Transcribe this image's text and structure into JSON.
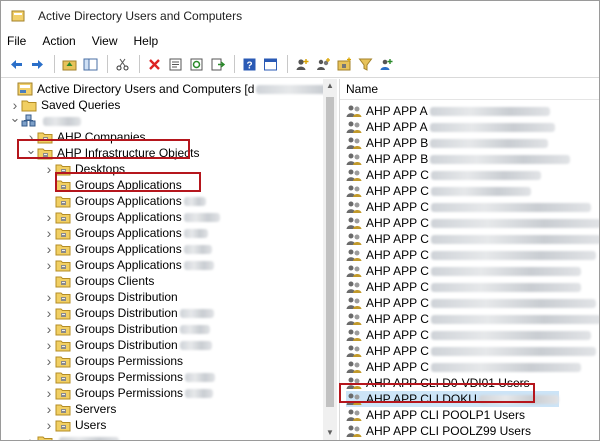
{
  "window": {
    "title": "Active Directory Users and Computers"
  },
  "menu": [
    "File",
    "Action",
    "View",
    "Help"
  ],
  "toolbar": [
    "back-arrow-icon",
    "forward-arrow-icon",
    "|",
    "up-folder-icon",
    "show-tree-icon",
    "|",
    "cut-icon",
    "|",
    "delete-icon",
    "properties-icon",
    "refresh-icon",
    "export-list-icon",
    "|",
    "help-icon",
    "console-icon",
    "|",
    "new-user-icon",
    "new-group-icon",
    "new-ou-icon",
    "filter-icon",
    "add-to-group-icon"
  ],
  "tree": [
    {
      "label": "Active Directory Users and Computers [d",
      "blur": [
        "dl",
        true
      ],
      "suffix": "]",
      "depth": 0,
      "expander": "none",
      "icon": "adcomputer",
      "blurw": 100
    },
    {
      "label": "Saved Queries",
      "depth": 1,
      "expander": "right",
      "icon": "folder"
    },
    {
      "label": "",
      "depth": 1,
      "expander": "down",
      "icon": "domain",
      "blurw": 38
    },
    {
      "label": "AHP Companies",
      "depth": 2,
      "expander": "right",
      "icon": "ou"
    },
    {
      "label": "AHP Infrastructure Objects",
      "depth": 2,
      "expander": "down",
      "icon": "ou"
    },
    {
      "label": "Desktops",
      "depth": 3,
      "expander": "right",
      "icon": "ou"
    },
    {
      "label": "Groups Applications",
      "depth": 3,
      "expander": "none",
      "icon": "ou"
    },
    {
      "label": "Groups Applications",
      "depth": 3,
      "expander": "none",
      "icon": "ou",
      "blurw": 22
    },
    {
      "label": "Groups Applications",
      "depth": 3,
      "expander": "right",
      "icon": "ou",
      "blurw": 36
    },
    {
      "label": "Groups Applications",
      "depth": 3,
      "expander": "right",
      "icon": "ou",
      "blurw": 24
    },
    {
      "label": "Groups Applications",
      "depth": 3,
      "expander": "right",
      "icon": "ou",
      "blurw": 28
    },
    {
      "label": "Groups Applications",
      "depth": 3,
      "expander": "right",
      "icon": "ou",
      "blurw": 30
    },
    {
      "label": "Groups Clients",
      "depth": 3,
      "expander": "none",
      "icon": "ou"
    },
    {
      "label": "Groups Distribution",
      "depth": 3,
      "expander": "right",
      "icon": "ou"
    },
    {
      "label": "Groups Distribution",
      "depth": 3,
      "expander": "right",
      "icon": "ou",
      "blurw": 34
    },
    {
      "label": "Groups Distribution",
      "depth": 3,
      "expander": "right",
      "icon": "ou",
      "blurw": 30
    },
    {
      "label": "Groups Distribution",
      "depth": 3,
      "expander": "right",
      "icon": "ou",
      "blurw": 32
    },
    {
      "label": "Groups Permissions",
      "depth": 3,
      "expander": "right",
      "icon": "ou"
    },
    {
      "label": "Groups Permissions",
      "depth": 3,
      "expander": "right",
      "icon": "ou",
      "blurw": 30
    },
    {
      "label": "Groups Permissions",
      "depth": 3,
      "expander": "right",
      "icon": "ou",
      "blurw": 28
    },
    {
      "label": "Servers",
      "depth": 3,
      "expander": "right",
      "icon": "ou"
    },
    {
      "label": "Users",
      "depth": 3,
      "expander": "right",
      "icon": "ou"
    },
    {
      "label": "",
      "depth": 2,
      "expander": "right",
      "icon": "ou",
      "blurw": 60
    }
  ],
  "list": {
    "column": "Name",
    "rows": [
      {
        "label": "AHP APP A",
        "blurw": 120
      },
      {
        "label": "AHP APP A",
        "blurw": 125
      },
      {
        "label": "AHP APP B",
        "blurw": 118
      },
      {
        "label": "AHP APP B",
        "blurw": 140
      },
      {
        "label": "AHP APP C",
        "blurw": 110
      },
      {
        "label": "AHP APP C",
        "blurw": 100
      },
      {
        "label": "AHP APP C",
        "blurw": 160
      },
      {
        "label": "AHP APP C",
        "blurw": 170
      },
      {
        "label": "AHP APP C",
        "blurw": 170
      },
      {
        "label": "AHP APP C",
        "blurw": 165
      },
      {
        "label": "AHP APP C",
        "blurw": 150
      },
      {
        "label": "AHP APP C",
        "blurw": 150
      },
      {
        "label": "AHP APP C",
        "blurw": 165
      },
      {
        "label": "AHP APP C",
        "blurw": 170
      },
      {
        "label": "AHP APP C",
        "blurw": 160
      },
      {
        "label": "AHP APP C",
        "blurw": 165
      },
      {
        "label": "AHP APP C",
        "blurw": 150
      },
      {
        "label": "AHP APP CLI D0-VDI01 Users",
        "blurw": 0
      },
      {
        "label": "AHP APP CLI DOKU",
        "blurw": 80,
        "selected": true
      },
      {
        "label": "AHP APP CLI POOLP1 Users",
        "blurw": 0
      },
      {
        "label": "AHP APP CLI POOLZ99 Users",
        "blurw": 0
      }
    ]
  },
  "colors": {
    "highlight": "#b5161d",
    "folder": "#e8c35a",
    "selection": "#cce4f7"
  }
}
